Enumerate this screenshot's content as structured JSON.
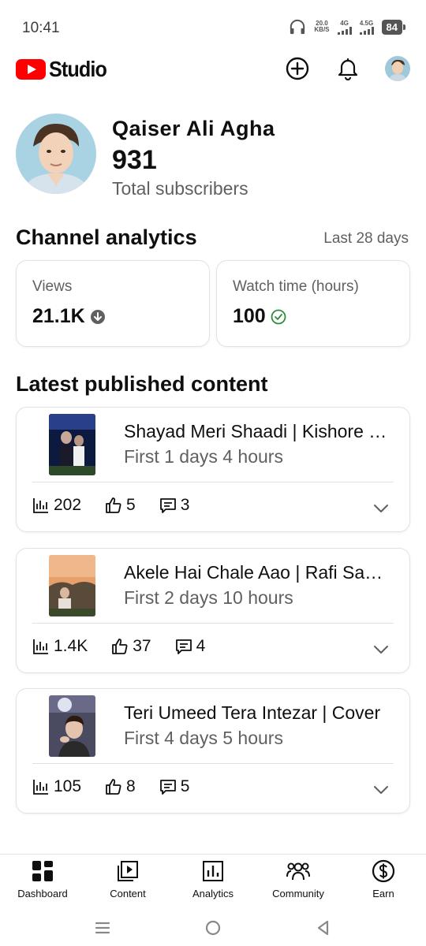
{
  "status_bar": {
    "time": "10:41",
    "net_speed_value": "20.0",
    "net_speed_unit": "KB/S",
    "signal1_label": "4G",
    "signal2_label": "4.5G",
    "battery": "84"
  },
  "app_bar": {
    "logo_text": "Studio",
    "brand_color": "#ff0000"
  },
  "channel": {
    "name": "Qaiser Ali Agha",
    "subscribers": "931",
    "subscribers_label": "Total subscribers"
  },
  "analytics": {
    "title": "Channel analytics",
    "period": "Last 28 days",
    "cards": [
      {
        "label": "Views",
        "value": "21.1K",
        "icon": "arrow-down-circle-icon"
      },
      {
        "label": "Watch time (hours)",
        "value": "100",
        "icon": "check-circle-icon"
      }
    ]
  },
  "latest": {
    "title": "Latest published content",
    "videos": [
      {
        "title": "Shayad Meri Shaadi | Kishore Kumar",
        "age": "First 1 days 4 hours",
        "views": "202",
        "likes": "5",
        "comments": "3"
      },
      {
        "title": "Akele Hai Chale Aao | Rafi Sahab",
        "age": "First 2 days 10 hours",
        "views": "1.4K",
        "likes": "37",
        "comments": "4"
      },
      {
        "title": "Teri Umeed Tera Intezar | Cover",
        "age": "First 4 days 5 hours",
        "views": "105",
        "likes": "8",
        "comments": "5"
      }
    ]
  },
  "bottom_nav": {
    "items": [
      {
        "label": "Dashboard",
        "icon": "dashboard-icon",
        "active": true
      },
      {
        "label": "Content",
        "icon": "content-icon",
        "active": false
      },
      {
        "label": "Analytics",
        "icon": "analytics-icon",
        "active": false
      },
      {
        "label": "Community",
        "icon": "community-icon",
        "active": false
      },
      {
        "label": "Earn",
        "icon": "earn-icon",
        "active": false
      }
    ]
  }
}
